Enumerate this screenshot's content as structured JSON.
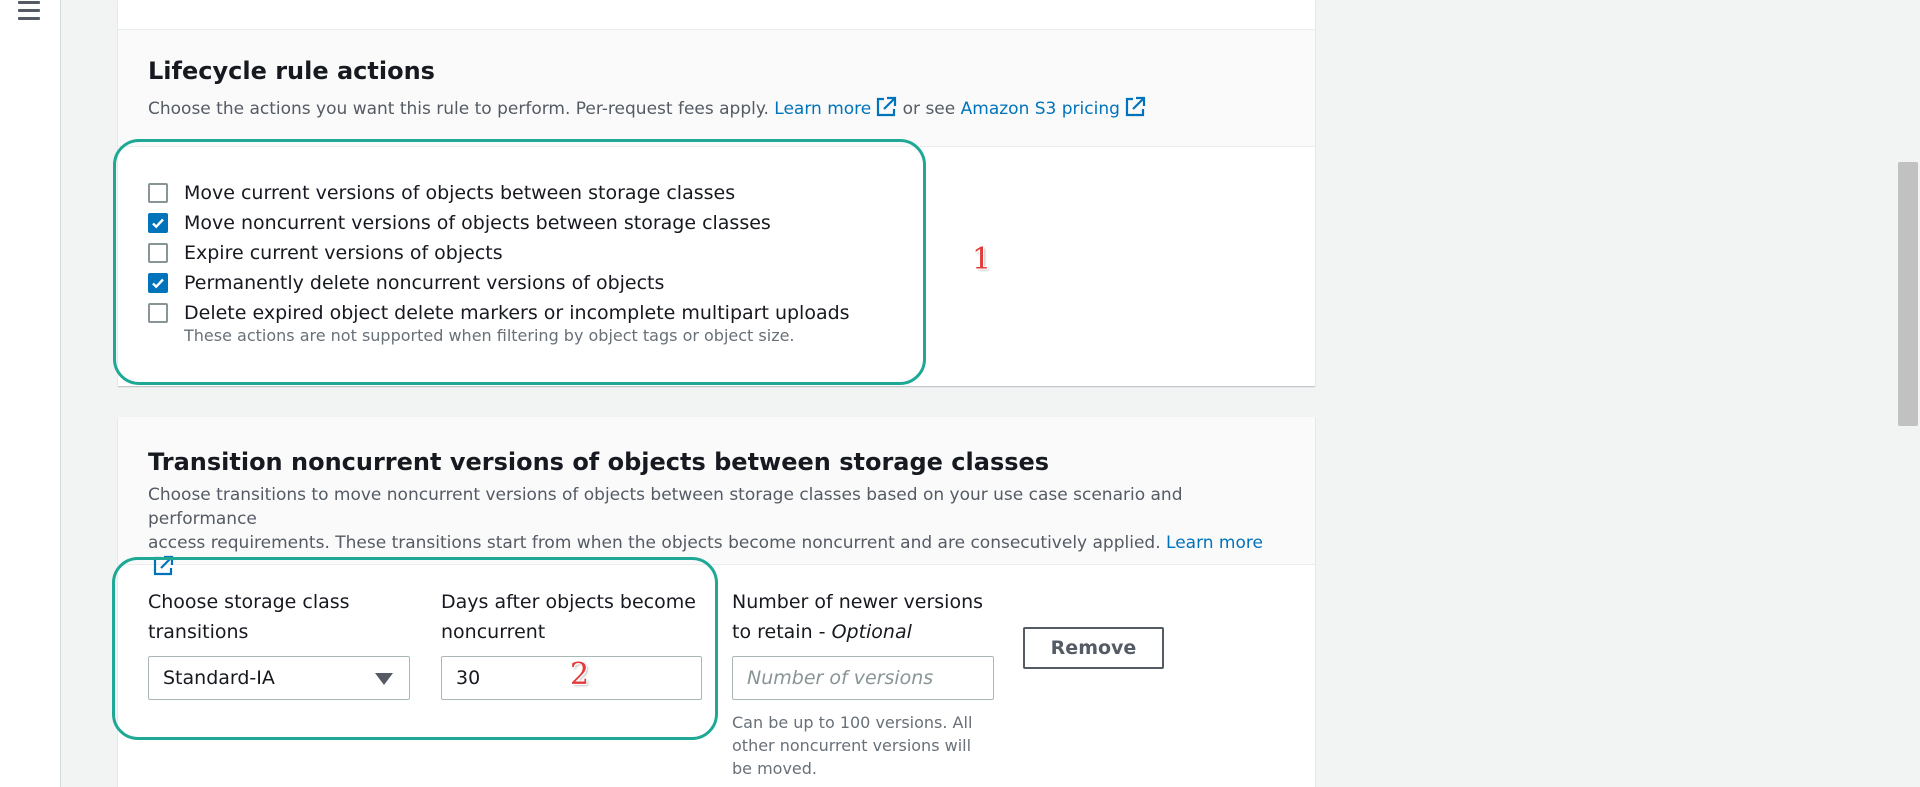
{
  "lifecycle": {
    "title": "Lifecycle rule actions",
    "desc_text": "Choose the actions you want this rule to perform. Per-request fees apply.",
    "learn_more": "Learn more",
    "or_see": "or see",
    "pricing_link": "Amazon S3 pricing",
    "actions": [
      {
        "label": "Move current versions of objects between storage classes",
        "checked": false
      },
      {
        "label": "Move noncurrent versions of objects between storage classes",
        "checked": true
      },
      {
        "label": "Expire current versions of objects",
        "checked": false
      },
      {
        "label": "Permanently delete noncurrent versions of objects",
        "checked": true
      },
      {
        "label": "Delete expired object delete markers or incomplete multipart uploads",
        "checked": false
      }
    ],
    "actions_hint": "These actions are not supported when filtering by object tags or object size."
  },
  "annotations": {
    "marker_1": "1",
    "marker_2": "2"
  },
  "transition": {
    "title": "Transition noncurrent versions of objects between storage classes",
    "desc_line1": "Choose transitions to move noncurrent versions of objects between storage classes based on your use case scenario and performance",
    "desc_line2": "access requirements. These transitions start from when the objects become noncurrent and are consecutively applied.",
    "learn_more": "Learn more",
    "storage_class_label_1": "Choose storage class",
    "storage_class_label_2": "transitions",
    "storage_class_value": "Standard-IA",
    "days_label_1": "Days after objects become",
    "days_label_2": "noncurrent",
    "days_value": "30",
    "versions_label_1": "Number of newer versions",
    "versions_label_2": "to retain -",
    "versions_optional": "Optional",
    "versions_placeholder": "Number of versions",
    "versions_hint_1": "Can be up to 100 versions. All",
    "versions_hint_2": "other noncurrent versions will",
    "versions_hint_3": "be moved.",
    "remove_button": "Remove"
  },
  "icons": {
    "menu": "hamburger-menu-icon",
    "external_link": "external-link-icon",
    "check": "check-icon",
    "dropdown": "caret-down-icon"
  },
  "colors": {
    "link": "#0073bb",
    "checkbox_checked": "#0073bb",
    "highlight": "#1fa896",
    "annotation_number": "#e23b3b"
  }
}
